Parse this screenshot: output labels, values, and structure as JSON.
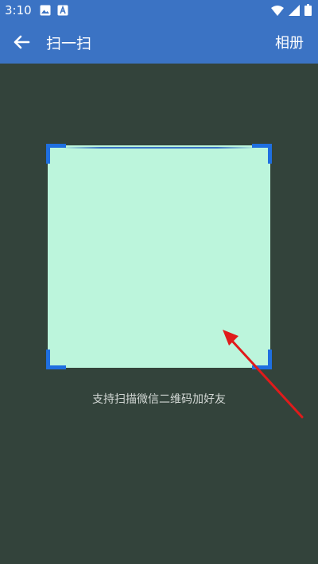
{
  "status_bar": {
    "time": "3:10",
    "left_icons": [
      "image-icon",
      "app-a-icon"
    ],
    "right_icons": [
      "wifi-icon",
      "signal-icon",
      "battery-icon"
    ]
  },
  "toolbar": {
    "title": "扫一扫",
    "album_label": "相册",
    "back_icon": "arrow-left-icon"
  },
  "scanner": {
    "hint": "支持扫描微信二维码加好友"
  },
  "colors": {
    "header": "#3b73c4",
    "background": "#33433b",
    "scan_area": "#bcf5dc",
    "corner": "#1f6fe0",
    "arrow": "#e01b1b"
  }
}
